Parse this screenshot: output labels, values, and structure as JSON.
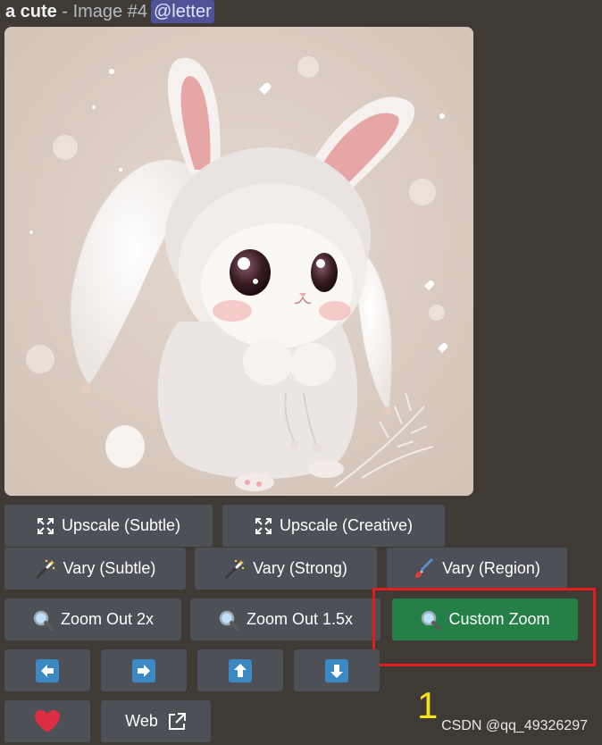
{
  "header": {
    "prompt": "a cute",
    "separator": " - ",
    "image_label": "Image #4",
    "mention": "@letter"
  },
  "image": {
    "subject": "bunny-in-hoodie-illustration"
  },
  "buttons": {
    "upscale_subtle": "Upscale (Subtle)",
    "upscale_creative": "Upscale (Creative)",
    "vary_subtle": "Vary (Subtle)",
    "vary_strong": "Vary (Strong)",
    "vary_region": "Vary (Region)",
    "zoom_out_2x": "Zoom Out 2x",
    "zoom_out_1_5x": "Zoom Out 1.5x",
    "custom_zoom": "Custom Zoom",
    "web": "Web"
  },
  "annotation": {
    "number": "1"
  },
  "watermark": "CSDN @qq_49326297",
  "colors": {
    "background": "#3f3a33",
    "button": "#4e5058",
    "primary_button": "#248046",
    "highlight": "#e41c1c",
    "annotation": "#f5e41a",
    "mention": "#4e5297",
    "arrow_blue": "#3b88c3",
    "heart_red": "#dd2e44"
  }
}
